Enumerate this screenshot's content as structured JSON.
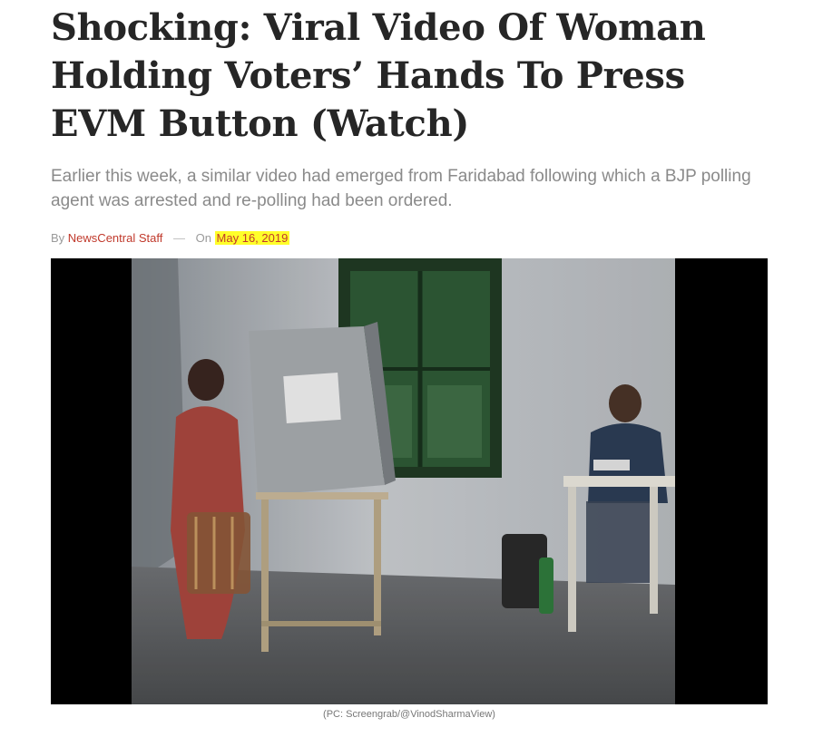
{
  "article": {
    "title": "Shocking: Viral Video Of Woman Holding Voters’ Hands To Press EVM Button (Watch)",
    "subtitle": "Earlier this week, a similar video had emerged from Faridabad following which a BJP polling agent was arrested and re-polling had been ordered.",
    "byline": {
      "by_label": "By",
      "author": "NewsCentral Staff",
      "separator": "—",
      "on_label": "On",
      "date": "May 16, 2019"
    }
  },
  "media": {
    "kind": "video-still",
    "caption": "(PC: Screengrab/@VinodSharmaView)"
  },
  "colors": {
    "headline": "#262626",
    "subtitle": "#8a8a8a",
    "author_link": "#c0392b",
    "date_highlight": "#ffff2a",
    "video_letterbox": "#000000"
  }
}
